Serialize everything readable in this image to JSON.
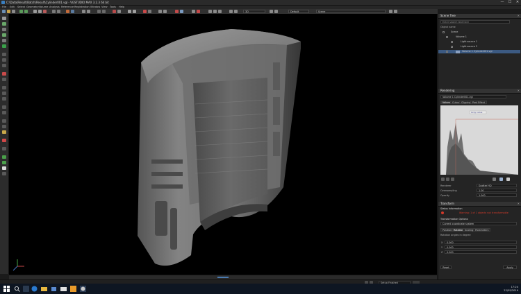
{
  "window": {
    "title": "C:\\Data\\Result\\Batch\\Result\\Cylinder001.vgl - VGSTUDIO MAX 3.2.3 64 bit",
    "controls": [
      "—",
      "☐",
      "✕"
    ]
  },
  "menu": [
    "File",
    "Edit",
    "Select",
    "Geometry",
    "Volume",
    "Analysis",
    "Reference",
    "Registration",
    "Window",
    "View",
    "Tools",
    "Help"
  ],
  "toolbar": {
    "view_mode": "3D",
    "render_preset": "Default",
    "search_value": "Scene"
  },
  "scene_tree": {
    "title": "Scene Tree",
    "search_placeholder": "Enter search text here",
    "group_label": "Object name",
    "items": [
      {
        "label": "Scene",
        "level": 0
      },
      {
        "label": "Volume 1",
        "level": 1
      },
      {
        "label": "Light source 1",
        "level": 2
      },
      {
        "label": "Light source 2",
        "level": 2
      },
      {
        "label": "Volume 1 Cylinder001.vgi",
        "level": 1,
        "selected": true
      }
    ]
  },
  "rendering": {
    "title": "Rendering",
    "preset_value": "Volume 1 Cylinder001.vgi",
    "tabs": [
      "Volume",
      "Cutout",
      "Clipping",
      "Post Effect"
    ],
    "active_tab": "Volume",
    "histogram_marker": "Gray value",
    "renderer_label": "Renderer",
    "renderer_value": "Scatter HQ",
    "oversampling_label": "Oversampling",
    "oversampling_value": "1.00",
    "opacity_label": "Opacity",
    "opacity_value": "1.000"
  },
  "transform": {
    "title": "Transform",
    "status_label": "Status Information",
    "warning_text": "Warning: 1 of 1 objects not transformable",
    "operation_label": "Transformation Options",
    "operation_value": "Current coordinate system",
    "tabs": [
      "Position",
      "Rotation",
      "Scaling",
      "Parameters"
    ],
    "active_tab": "Rotation",
    "rotation_caption": "Rotation angles in degree",
    "axes": [
      "X",
      "Y",
      "Z"
    ],
    "values": [
      "0.000",
      "0.000",
      "0.000"
    ],
    "reset_label": "Reset",
    "apply_label": "Apply"
  },
  "statusbar": {
    "text": "Setup Finished"
  },
  "taskbar": {
    "time": "17:24",
    "date": "22/05/2019"
  },
  "colors": {
    "accent": "#3c5a82",
    "warning": "#d23a2a",
    "background": "#000000"
  }
}
